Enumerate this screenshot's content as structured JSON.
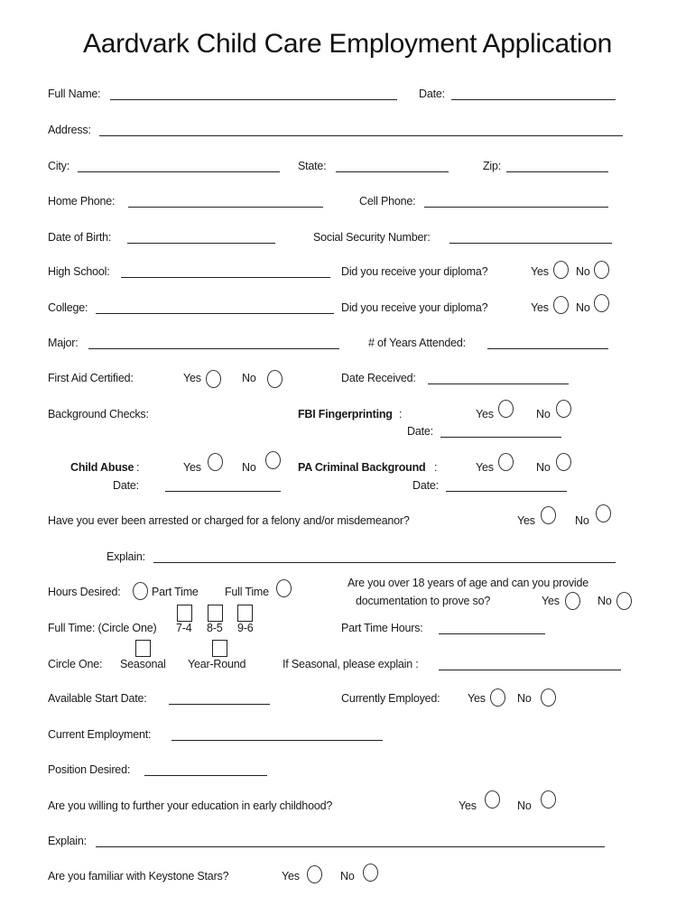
{
  "title": "Aardvark Child Care Employment Application",
  "fields": {
    "full_name": "Full Name:",
    "date": "Date:",
    "address": "Address:",
    "city": "City:",
    "state": "State:",
    "zip": "Zip:",
    "home_phone": "Home Phone:",
    "cell_phone": "Cell Phone:",
    "dob": "Date of Birth:",
    "ssn": "Social Security Number:",
    "high_school": "High School:",
    "diploma_q": "Did you receive your diploma?",
    "college": "College:",
    "major": "Major:",
    "years_attended": "# of Years Attended:",
    "first_aid": "First Aid Certified:",
    "date_received": "Date Received:",
    "background_checks": "Background Checks:",
    "fbi": "FBI Fingerprinting",
    "colon": ":",
    "child_abuse": "Child Abuse",
    "pa_criminal": "PA Criminal Background",
    "arrested_q": "Have you ever been arrested or charged for a felony and/or misdemeanor?",
    "explain": "Explain:",
    "hours_desired": "Hours Desired:",
    "part_time": "Part Time",
    "full_time": "Full Time",
    "over18_line1": "Are you over 18 years of age and can you provide",
    "over18_line2": "documentation to prove so?",
    "full_time_circle": "Full Time: (Circle One)",
    "shift_74": "7-4",
    "shift_85": "8-5",
    "shift_96": "9-6",
    "part_time_hours": "Part Time Hours:",
    "circle_one": "Circle One:",
    "seasonal": "Seasonal",
    "year_round": "Year-Round",
    "seasonal_explain": "If Seasonal, please explain :",
    "start_date": "Available Start Date:",
    "currently_employed": "Currently Employed:",
    "current_employment": "Current Employment:",
    "position_desired": "Position Desired:",
    "further_education_q": "Are you willing to further your education in early childhood?",
    "keystone_q": "Are you familiar with Keystone Stars?"
  },
  "options": {
    "yes": "Yes",
    "no": "No"
  }
}
